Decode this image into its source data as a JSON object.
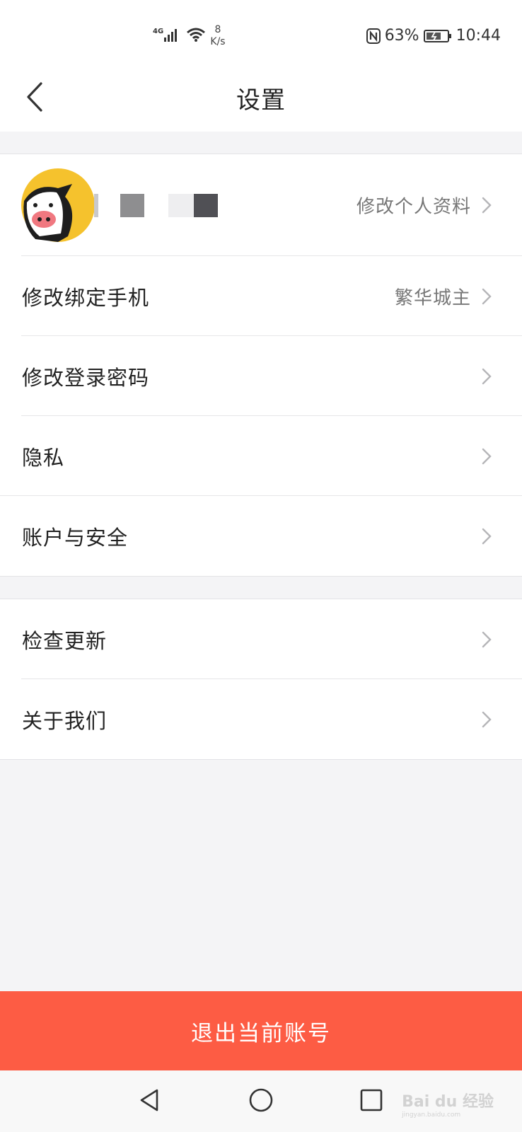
{
  "status_bar": {
    "network": "4G",
    "speed_value": "8",
    "speed_unit": "K/s",
    "battery": "63%",
    "time": "10:44"
  },
  "header": {
    "title": "设置"
  },
  "profile": {
    "edit_label": "修改个人资料"
  },
  "items": [
    {
      "label": "修改绑定手机",
      "value": "繁华城主"
    },
    {
      "label": "修改登录密码"
    },
    {
      "label": "隐私"
    },
    {
      "label": "账户与安全"
    }
  ],
  "items2": [
    {
      "label": "检查更新"
    },
    {
      "label": "关于我们"
    }
  ],
  "logout": {
    "label": "退出当前账号"
  },
  "watermark": {
    "brand": "Bai du 经验",
    "url": "jingyan.baidu.com"
  },
  "colors": {
    "accent": "#fd5c44",
    "background": "#f4f4f6",
    "avatar": "#f5c22d"
  }
}
